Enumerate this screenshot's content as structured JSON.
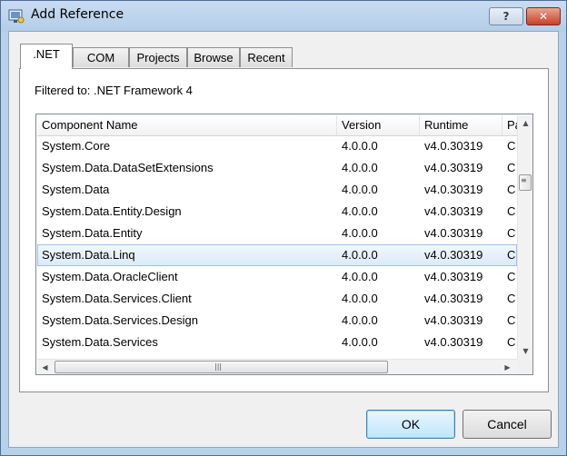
{
  "window": {
    "title": "Add Reference",
    "help_label": "?",
    "close_label": "✕"
  },
  "tabs": [
    {
      "label": ".NET",
      "active": true
    },
    {
      "label": "COM",
      "active": false
    },
    {
      "label": "Projects",
      "active": false
    },
    {
      "label": "Browse",
      "active": false
    },
    {
      "label": "Recent",
      "active": false
    }
  ],
  "filter_text": "Filtered to: .NET Framework 4",
  "list": {
    "columns": [
      "Component Name",
      "Version",
      "Runtime",
      "Pa"
    ],
    "rows": [
      {
        "name": "System.Core",
        "version": "4.0.0.0",
        "runtime": "v4.0.30319",
        "path": "C"
      },
      {
        "name": "System.Data.DataSetExtensions",
        "version": "4.0.0.0",
        "runtime": "v4.0.30319",
        "path": "C"
      },
      {
        "name": "System.Data",
        "version": "4.0.0.0",
        "runtime": "v4.0.30319",
        "path": "C"
      },
      {
        "name": "System.Data.Entity.Design",
        "version": "4.0.0.0",
        "runtime": "v4.0.30319",
        "path": "C"
      },
      {
        "name": "System.Data.Entity",
        "version": "4.0.0.0",
        "runtime": "v4.0.30319",
        "path": "C"
      },
      {
        "name": "System.Data.Linq",
        "version": "4.0.0.0",
        "runtime": "v4.0.30319",
        "path": "C",
        "selected": true
      },
      {
        "name": "System.Data.OracleClient",
        "version": "4.0.0.0",
        "runtime": "v4.0.30319",
        "path": "C"
      },
      {
        "name": "System.Data.Services.Client",
        "version": "4.0.0.0",
        "runtime": "v4.0.30319",
        "path": "C"
      },
      {
        "name": "System.Data.Services.Design",
        "version": "4.0.0.0",
        "runtime": "v4.0.30319",
        "path": "C"
      },
      {
        "name": "System.Data.Services",
        "version": "4.0.0.0",
        "runtime": "v4.0.30319",
        "path": "C"
      }
    ]
  },
  "buttons": {
    "ok": "OK",
    "cancel": "Cancel"
  },
  "colors": {
    "title_bar": "#b9d1ea",
    "selection": "#dbeaf9",
    "close_button": "#c7412a"
  }
}
